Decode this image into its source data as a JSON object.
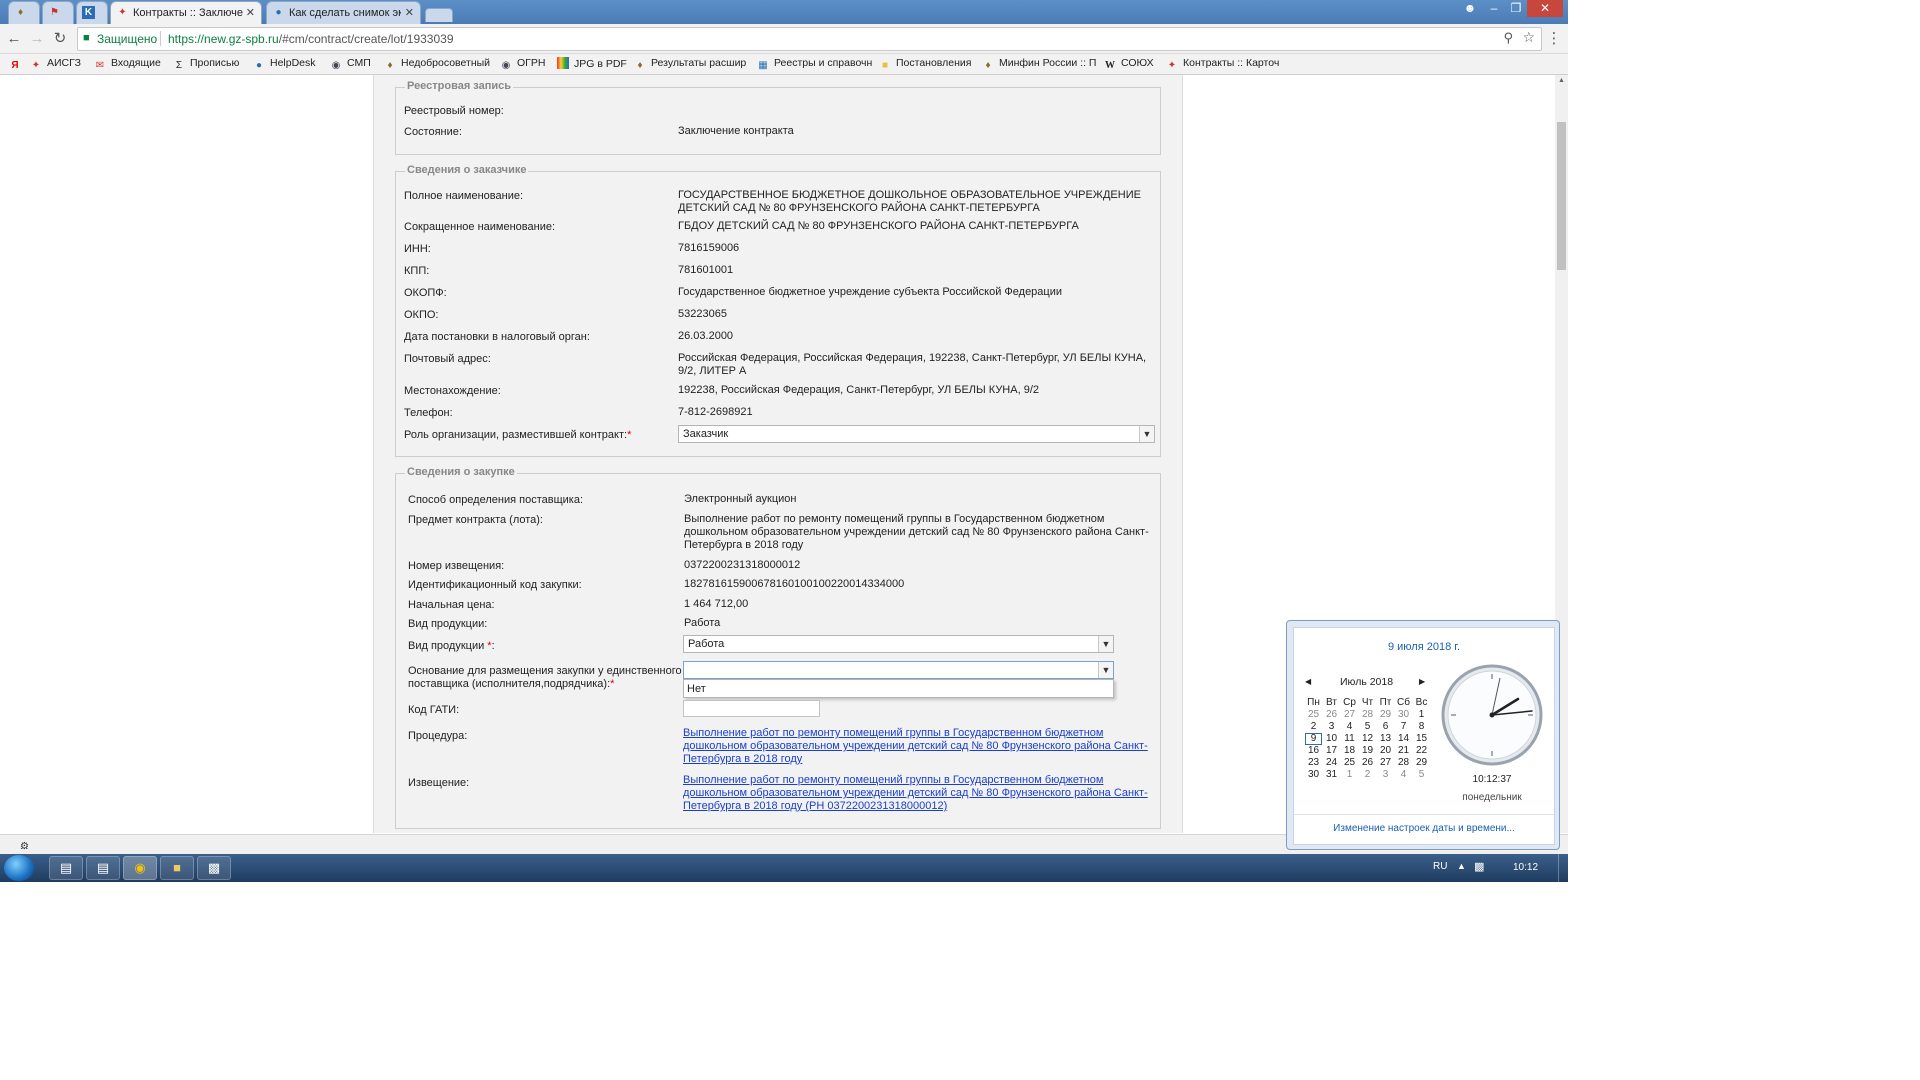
{
  "browser": {
    "tabs": [
      {
        "title": "",
        "icon": "eagle-icon"
      },
      {
        "title": "",
        "icon": "flag-icon"
      },
      {
        "title": "",
        "icon": "k-icon"
      },
      {
        "title": "Контракты :: Заключени",
        "icon": "contracts-icon",
        "active": true
      },
      {
        "title": "Как сделать снимок экр",
        "icon": "globe-icon"
      }
    ],
    "secure_label": "Защищено",
    "url_host": "https://new.gz-spb.ru",
    "url_path": "/#cm/contract/create/lot/1933039",
    "bookmarks": [
      {
        "label": "",
        "icon": "yandex-icon"
      },
      {
        "label": "АИСГЗ",
        "icon": "contracts-icon"
      },
      {
        "label": "Входящие",
        "icon": "mail-icon"
      },
      {
        "label": "Прописью",
        "icon": "sigma-icon"
      },
      {
        "label": "HelpDesk",
        "icon": "globe-icon"
      },
      {
        "label": "СМП",
        "icon": "seal-icon"
      },
      {
        "label": "Недобросоветный",
        "icon": "eagle-icon"
      },
      {
        "label": "ОГРН",
        "icon": "seal-icon"
      },
      {
        "label": "JPG в PDF",
        "icon": "colors-icon"
      },
      {
        "label": "Результаты расшир",
        "icon": "eagle-icon"
      },
      {
        "label": "Реестры и справочн",
        "icon": "registry-icon"
      },
      {
        "label": "Постановления",
        "icon": "folder-icon"
      },
      {
        "label": "Минфин России :: П",
        "icon": "eagle-icon"
      },
      {
        "label": "СОЮХ",
        "icon": "w-icon"
      },
      {
        "label": "Контракты :: Карточ",
        "icon": "contracts-icon"
      }
    ]
  },
  "registry": {
    "legend": "Реестровая запись",
    "number_label": "Реестровый номер:",
    "number_value": "",
    "state_label": "Состояние:",
    "state_value": "Заключение контракта"
  },
  "customer": {
    "legend": "Сведения о заказчике",
    "fields": [
      {
        "label": "Полное наименование:",
        "value": "ГОСУДАРСТВЕННОЕ БЮДЖЕТНОЕ ДОШКОЛЬНОЕ ОБРАЗОВАТЕЛЬНОЕ УЧРЕЖДЕНИЕ ДЕТСКИЙ САД № 80 ФРУНЗЕНСКОГО РАЙОНА САНКТ-ПЕТЕРБУРГА"
      },
      {
        "label": "Сокращенное наименование:",
        "value": "ГБДОУ ДЕТСКИЙ САД № 80 ФРУНЗЕНСКОГО РАЙОНА САНКТ-ПЕТЕРБУРГА"
      },
      {
        "label": "ИНН:",
        "value": "7816159006"
      },
      {
        "label": "КПП:",
        "value": "781601001"
      },
      {
        "label": "ОКОПФ:",
        "value": "Государственное бюджетное учреждение субъекта Российской Федерации"
      },
      {
        "label": "ОКПО:",
        "value": "53223065"
      },
      {
        "label": "Дата постановки в налоговый орган:",
        "value": "26.03.2000"
      },
      {
        "label": "Почтовый адрес:",
        "value": "Российская Федерация, Российская Федерация, 192238, Санкт-Петербург, УЛ БЕЛЫ КУНА, 9/2, ЛИТЕР А"
      },
      {
        "label": "Местонахождение:",
        "value": "192238, Российская Федерация, Санкт-Петербург, УЛ БЕЛЫ КУНА, 9/2"
      },
      {
        "label": "Телефон:",
        "value": "7-812-2698921"
      }
    ],
    "role_label": "Роль организации, разместившей контракт:",
    "role_required": "*",
    "role_value": "Заказчик"
  },
  "purchase": {
    "legend": "Сведения о закупке",
    "fields": [
      {
        "label": "Способ определения поставщика:",
        "value": "Электронный аукцион"
      },
      {
        "label": "Предмет контракта (лота):",
        "value": "Выполнение работ по ремонту помещений группы в Государственном бюджетном дошкольном образовательном учреждении детский сад № 80 Фрунзенского района Санкт-Петербурга в 2018 году"
      },
      {
        "label": "Номер извещения:",
        "value": "0372200231318000012"
      },
      {
        "label": "Идентификационный код закупки:",
        "value": "182781615900678160100100220014334000"
      },
      {
        "label": "Начальная цена:",
        "value": "1 464 712,00"
      },
      {
        "label": "Вид продукции:",
        "value": "Работа"
      }
    ],
    "product_type_label": "Вид продукции",
    "product_type_required": "*",
    "product_type_colon": ":",
    "product_type_value": "Работа",
    "basis_label_line1": "Основание для размещения закупки у единственного",
    "basis_label_line2": "поставщика (исполнителя,подрядчика):",
    "basis_required": "*",
    "basis_value": "",
    "basis_option": "Нет",
    "gati_label": "Код ГАТИ:",
    "procedure_label": "Процедура:",
    "procedure_link": "Выполнение работ по ремонту помещений группы в Государственном бюджетном дошкольном образовательном учреждении детский сад № 80 Фрунзенского района Санкт-Петербурга в 2018 году",
    "notice_label": "Извещение:",
    "notice_link": "Выполнение работ по ремонту помещений группы в Государственном бюджетном дошкольном образовательном учреждении детский сад № 80 Фрунзенского района Санкт-Петербурга в 2018 году (РН 0372200231318000012)"
  },
  "status_text": "...",
  "calendar": {
    "date_heading": "9 июля 2018 г.",
    "month": "Июль 2018",
    "weekdays": [
      "Пн",
      "Вт",
      "Ср",
      "Чт",
      "Пт",
      "Сб",
      "Вс"
    ],
    "weeks": [
      [
        "25",
        "26",
        "27",
        "28",
        "29",
        "30",
        "1"
      ],
      [
        "2",
        "3",
        "4",
        "5",
        "6",
        "7",
        "8"
      ],
      [
        "9",
        "10",
        "11",
        "12",
        "13",
        "14",
        "15"
      ],
      [
        "16",
        "17",
        "18",
        "19",
        "20",
        "21",
        "22"
      ],
      [
        "23",
        "24",
        "25",
        "26",
        "27",
        "28",
        "29"
      ],
      [
        "30",
        "31",
        "1",
        "2",
        "3",
        "4",
        "5"
      ]
    ],
    "today": "9",
    "time": "10:12:37",
    "weekday": "понедельник",
    "settings_link": "Изменение настроек даты и времени..."
  },
  "taskbar": {
    "lang": "RU",
    "clock": "10:12"
  }
}
